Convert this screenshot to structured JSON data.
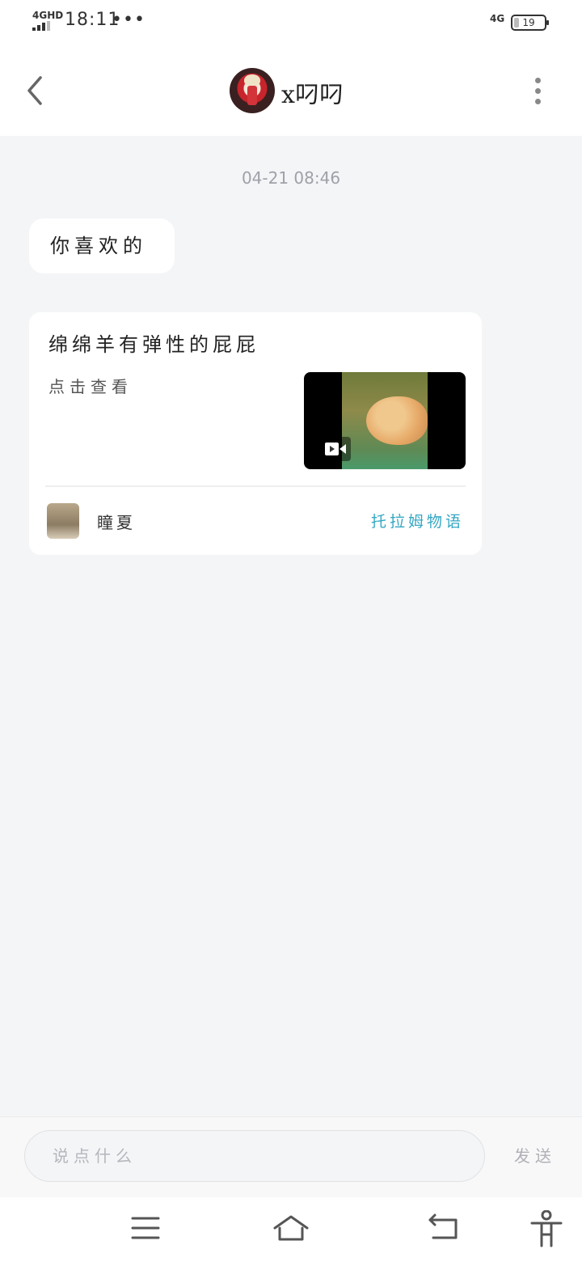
{
  "status_bar": {
    "network": "4GHD",
    "time": "18:11",
    "dots": "•••",
    "mobile_data": "4G",
    "battery": "19"
  },
  "header": {
    "title": "x叼叼",
    "back_icon": "chevron-left-icon",
    "more_icon": "more-vertical-icon"
  },
  "chat": {
    "timestamp": "04-21 08:46",
    "message_text": "你喜欢的",
    "shared_card": {
      "title": "绵绵羊有弹性的屁屁",
      "subtitle": "点击查看",
      "video_icon": "video-camera-icon",
      "author": "瞳夏",
      "group": "托拉姆物语"
    }
  },
  "input": {
    "placeholder": "说点什么",
    "send_label": "发送"
  },
  "nav": {
    "menu_icon": "menu-icon",
    "home_icon": "home-icon",
    "back_icon": "return-icon",
    "accessibility_icon": "accessibility-icon"
  }
}
